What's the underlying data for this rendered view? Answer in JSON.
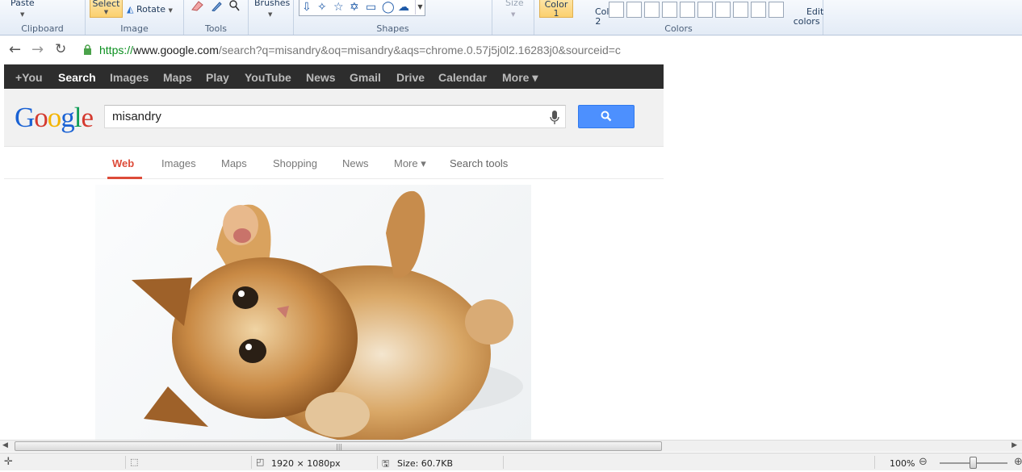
{
  "ribbon": {
    "clipboard": {
      "paste_label": "Paste",
      "group_label": "Clipboard"
    },
    "image": {
      "select_label": "Select",
      "rotate_label": "Rotate",
      "group_label": "Image"
    },
    "tools": {
      "group_label": "Tools"
    },
    "brushes": {
      "label": "Brushes"
    },
    "shapes": {
      "group_label": "Shapes"
    },
    "size": {
      "label": "Size"
    },
    "colors": {
      "color1_label": "Color\n1",
      "color2_label": "Color\n2",
      "edit_colors_label": "Edit\ncolors",
      "group_label": "Colors",
      "accent_selected": "#fbd06e"
    }
  },
  "browser": {
    "url": {
      "scheme": "https://",
      "domain": "www.google.com",
      "rest": "/search?q=misandry&oq=misandry&aqs=chrome.0.57j5j0l2.16283j0&sourceid=c"
    },
    "gbar_items": [
      "+You",
      "Search",
      "Images",
      "Maps",
      "Play",
      "YouTube",
      "News",
      "Gmail",
      "Drive",
      "Calendar",
      "More ▾"
    ],
    "logo": {
      "letters": [
        "G",
        "o",
        "o",
        "g",
        "l",
        "e"
      ],
      "colors": [
        "#1a62d4",
        "#d43a2f",
        "#f4b400",
        "#1a62d4",
        "#109d58",
        "#d43a2f"
      ]
    },
    "search": {
      "value": "misandry"
    },
    "tabs": [
      "Web",
      "Images",
      "Maps",
      "Shopping",
      "News",
      "More ▾",
      "Search tools"
    ]
  },
  "status": {
    "dimensions": "1920 × 1080px",
    "size": "Size: 60.7KB",
    "zoom": "100%",
    "zoom_level_percent": 100
  }
}
